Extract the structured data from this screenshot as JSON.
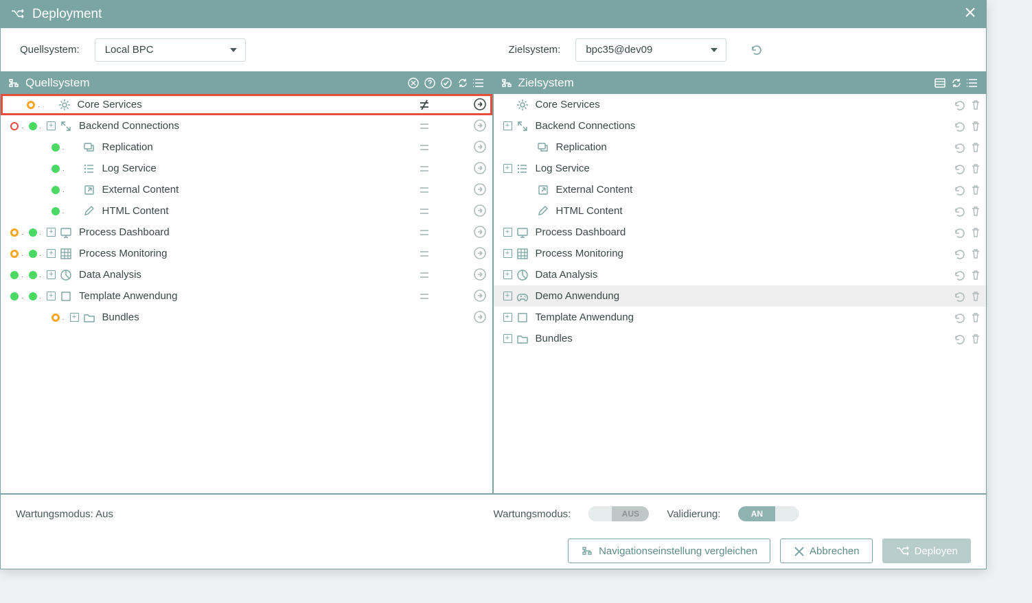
{
  "title": "Deployment",
  "sourceLabel": "Quellsystem:",
  "sourceValue": "Local BPC",
  "targetLabel": "Zielsystem:",
  "targetValue": "bpc35@dev09",
  "sourcePanel": {
    "title": "Quellsystem",
    "rows": [
      {
        "indent": 0,
        "d1": "orange",
        "exp": false,
        "ikey": "gear",
        "label": "Core Services",
        "status": "neq",
        "actActive": true,
        "highlight": true
      },
      {
        "indent": 0,
        "d0": "red-o",
        "d1": "green",
        "exp": true,
        "ikey": "expand",
        "label": "Backend Connections",
        "status": "eq"
      },
      {
        "indent": 1,
        "d1": "green",
        "exp": false,
        "ikey": "repl",
        "label": "Replication",
        "status": "eq"
      },
      {
        "indent": 1,
        "d1": "green",
        "exp": false,
        "ikey": "list",
        "label": "Log Service",
        "status": "eq"
      },
      {
        "indent": 1,
        "d1": "green",
        "exp": false,
        "ikey": "extern",
        "label": "External Content",
        "status": "eq"
      },
      {
        "indent": 1,
        "d1": "green",
        "exp": false,
        "ikey": "pen",
        "label": "HTML Content",
        "status": "eq"
      },
      {
        "indent": 0,
        "d0": "orange",
        "d1": "green",
        "exp": true,
        "ikey": "monitor",
        "label": "Process Dashboard",
        "status": "eq"
      },
      {
        "indent": 0,
        "d0": "orange",
        "d1": "green",
        "exp": true,
        "ikey": "grid",
        "label": "Process Monitoring",
        "status": "eq"
      },
      {
        "indent": 0,
        "d0": "green",
        "d1": "green",
        "exp": true,
        "ikey": "pie",
        "label": "Data Analysis",
        "status": "eq"
      },
      {
        "indent": 0,
        "d0": "green",
        "d1": "green",
        "exp": true,
        "ikey": "square",
        "label": "Template Anwendung",
        "status": "eq"
      },
      {
        "indent": 1,
        "d1": "orange",
        "exp": true,
        "ikey": "folder",
        "label": "Bundles",
        "status": ""
      }
    ]
  },
  "targetPanel": {
    "title": "Zielsystem",
    "rows": [
      {
        "indent": 0,
        "exp": false,
        "ikey": "gear",
        "label": "Core Services"
      },
      {
        "indent": 0,
        "exp": true,
        "ikey": "expand",
        "label": "Backend Connections"
      },
      {
        "indent": 1,
        "exp": false,
        "ikey": "repl",
        "label": "Replication"
      },
      {
        "indent": 0,
        "exp": true,
        "ikey": "list",
        "label": "Log Service"
      },
      {
        "indent": 1,
        "exp": false,
        "ikey": "extern",
        "label": "External Content"
      },
      {
        "indent": 1,
        "exp": false,
        "ikey": "pen",
        "label": "HTML Content"
      },
      {
        "indent": 0,
        "exp": true,
        "ikey": "monitor",
        "label": "Process Dashboard"
      },
      {
        "indent": 0,
        "exp": true,
        "ikey": "grid",
        "label": "Process Monitoring"
      },
      {
        "indent": 0,
        "exp": true,
        "ikey": "pie",
        "label": "Data Analysis"
      },
      {
        "indent": 0,
        "exp": true,
        "ikey": "game",
        "label": "Demo Anwendung",
        "selected": true
      },
      {
        "indent": 0,
        "exp": true,
        "ikey": "square",
        "label": "Template Anwendung"
      },
      {
        "indent": 0,
        "exp": true,
        "ikey": "folder",
        "label": "Bundles"
      }
    ]
  },
  "footer": {
    "maintLeft": "Wartungsmodus: Aus",
    "maintLabel": "Wartungsmodus:",
    "maintToggle": "AUS",
    "validLabel": "Validierung:",
    "validToggle": "AN",
    "navCompare": "Navigationseinstellung vergleichen",
    "cancel": "Abbrechen",
    "deploy": "Deployen"
  }
}
